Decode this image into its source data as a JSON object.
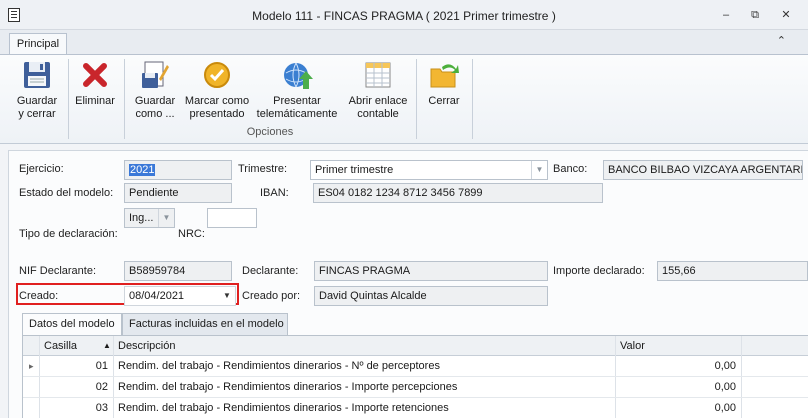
{
  "window": {
    "title": "Modelo 111 - FINCAS PRAGMA ( 2021 Primer trimestre )",
    "minimize_glyph": "–",
    "maximize_glyph": "⧉",
    "close_glyph": "✕"
  },
  "ribbon": {
    "tab_label": "Principal",
    "collapse_glyph": "⌃",
    "buttons": [
      {
        "icon": "floppy-disk-icon",
        "label": "Guardar\ny cerrar"
      },
      {
        "icon": "delete-x-icon",
        "label": "Eliminar"
      },
      {
        "icon": "save-as-icon",
        "label": "Guardar\ncomo ..."
      },
      {
        "icon": "check-badge-icon",
        "label": "Marcar como\npresentado"
      },
      {
        "icon": "globe-upload-icon",
        "label": "Presentar\ntelemáticamente"
      },
      {
        "icon": "spreadsheet-icon",
        "label": "Abrir enlace\ncontable"
      },
      {
        "icon": "exit-folder-icon",
        "label": "Cerrar"
      }
    ],
    "group_label": "Opciones"
  },
  "form": {
    "ejercicio_label": "Ejercicio:",
    "ejercicio_value": "2021",
    "trimestre_label": "Trimestre:",
    "trimestre_value": "Primer trimestre",
    "banco_label": "Banco:",
    "banco_value": "BANCO BILBAO VIZCAYA ARGENTARIA,",
    "estado_label": "Estado del modelo:",
    "estado_value": "Pendiente",
    "iban_label": "IBAN:",
    "iban_value": "ES04 0182 1234 8712 3456 7899",
    "tipo_label": "Tipo de declaración:",
    "tipo_value": "Ing...",
    "nrc_label": "NRC:",
    "nrc_value": "",
    "nif_label": "NIF Declarante:",
    "nif_value": "B58959784",
    "declarante_label": "Declarante:",
    "declarante_value": "FINCAS PRAGMA",
    "importe_label": "Importe declarado:",
    "importe_value": "155,66",
    "creado_label": "Creado:",
    "creado_value": "08/04/2021",
    "creado_por_label": "Creado por:",
    "creado_por_value": "David Quintas Alcalde"
  },
  "detail_tabs": [
    "Datos del modelo",
    "Facturas incluidas en el modelo"
  ],
  "grid": {
    "columns": [
      "Casilla",
      "Descripción",
      "Valor"
    ],
    "sort_glyph": "▲",
    "current_row_glyph": "▸",
    "rows": [
      {
        "casilla": "01",
        "descripcion": "Rendim. del trabajo - Rendimientos dinerarios - Nº de perceptores",
        "valor": "0,00"
      },
      {
        "casilla": "02",
        "descripcion": "Rendim. del trabajo - Rendimientos dinerarios - Importe percepciones",
        "valor": "0,00"
      },
      {
        "casilla": "03",
        "descripcion": "Rendim. del trabajo - Rendimientos dinerarios - Importe retenciones",
        "valor": "0,00"
      }
    ]
  },
  "colors": {
    "highlight_border": "#e02020",
    "selection": "#3a78d8"
  }
}
